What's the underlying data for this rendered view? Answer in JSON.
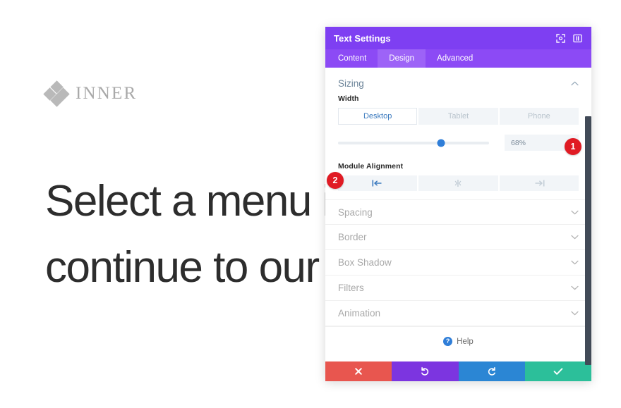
{
  "background": {
    "brand_name": "INNER",
    "brand_logo_icon": "diamond-cluster-icon",
    "headline_line1": "Select a menu it",
    "headline_line2": "continue to our w"
  },
  "panel": {
    "title": "Text Settings",
    "header_icons": [
      {
        "name": "expand-icon",
        "label": "Expand"
      },
      {
        "name": "layout-view-icon",
        "label": "Change Layout"
      }
    ],
    "tabs": [
      {
        "label": "Content",
        "active": false
      },
      {
        "label": "Design",
        "active": true
      },
      {
        "label": "Advanced",
        "active": false
      }
    ],
    "sizing": {
      "title": "Sizing",
      "expanded": true,
      "chevron_icon": "chevron-up-icon",
      "width_label": "Width",
      "device_options": [
        {
          "label": "Desktop",
          "active": true
        },
        {
          "label": "Tablet",
          "active": false
        },
        {
          "label": "Phone",
          "active": false
        }
      ],
      "width_value": "68%",
      "width_percent": 68,
      "module_alignment_label": "Module Alignment",
      "alignment_options": [
        {
          "name": "align-left-icon",
          "label": "Left",
          "active": true
        },
        {
          "name": "align-center-icon",
          "label": "Center",
          "active": false
        },
        {
          "name": "align-right-icon",
          "label": "Right",
          "active": false
        }
      ]
    },
    "collapsed_sections": [
      {
        "label": "Spacing",
        "chevron_icon": "chevron-down-icon"
      },
      {
        "label": "Border",
        "chevron_icon": "chevron-down-icon"
      },
      {
        "label": "Box Shadow",
        "chevron_icon": "chevron-down-icon"
      },
      {
        "label": "Filters",
        "chevron_icon": "chevron-down-icon"
      },
      {
        "label": "Animation",
        "chevron_icon": "chevron-down-icon"
      }
    ],
    "help": {
      "label": "Help",
      "icon": "question-mark-icon"
    },
    "footer_buttons": [
      {
        "name": "cancel-button",
        "icon": "close-x-icon",
        "color": "#e8564f"
      },
      {
        "name": "undo-button",
        "icon": "undo-arrow-icon",
        "color": "#7c35e0"
      },
      {
        "name": "redo-button",
        "icon": "redo-arrow-icon",
        "color": "#2b86d4"
      },
      {
        "name": "save-button",
        "icon": "checkmark-icon",
        "color": "#2cbf9a"
      }
    ],
    "scrollbar_color": "#414a57"
  },
  "callouts": [
    {
      "number": "1"
    },
    {
      "number": "2"
    }
  ],
  "colors": {
    "panel_header": "#7e3ff2",
    "tab_bar": "#8c4af5",
    "tab_active": "#9d63f7",
    "accent_blue": "#2f7ed8",
    "callout_red": "#e01b24"
  }
}
